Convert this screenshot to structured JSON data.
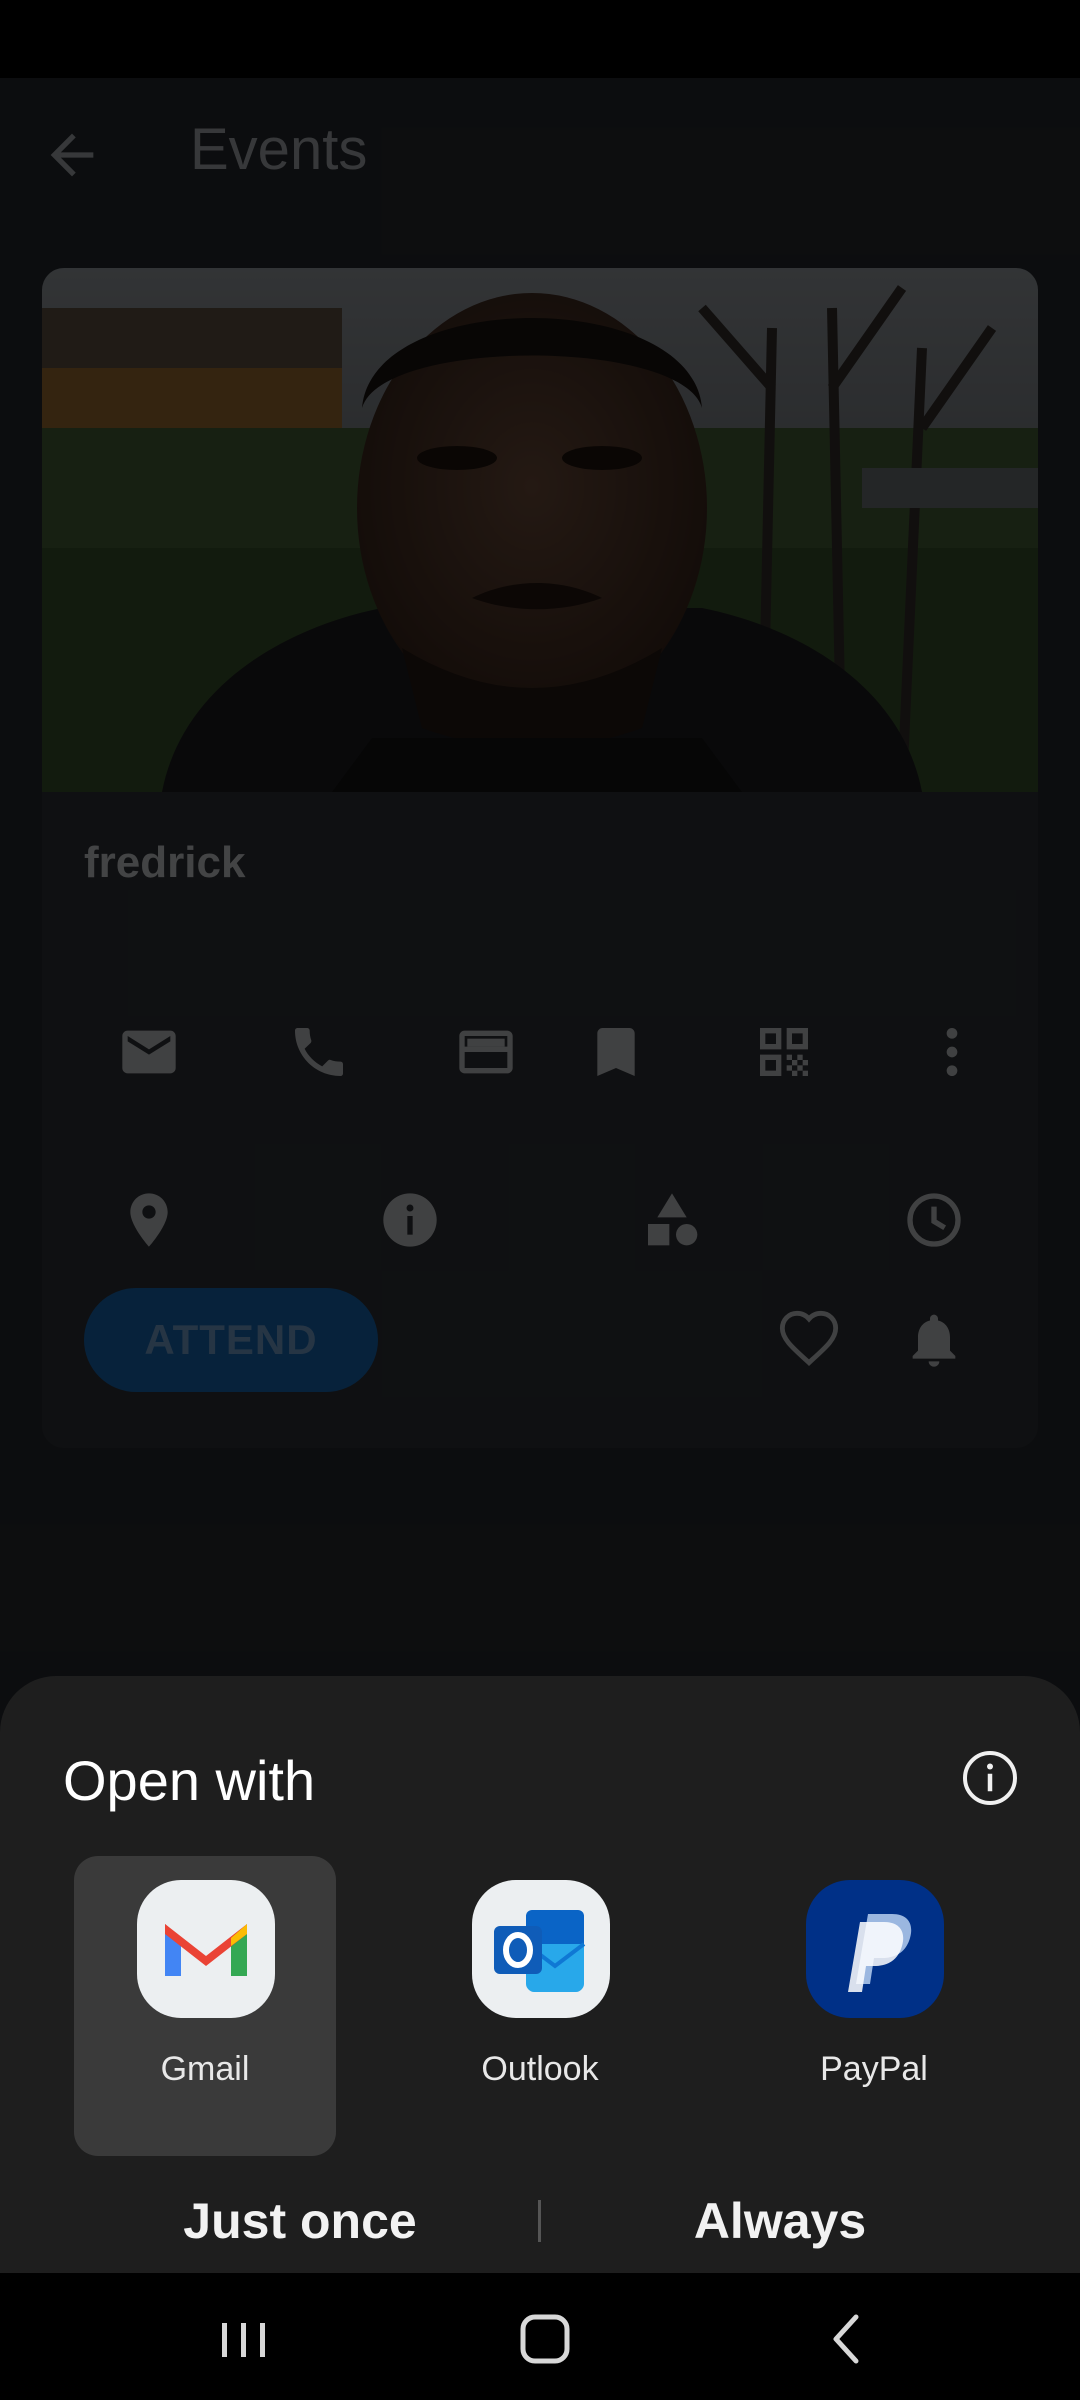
{
  "app_bar": {
    "title": "Events",
    "back_icon": "arrow-back-icon"
  },
  "event_card": {
    "person_name": "fredrick",
    "actions_row1": [
      "email-icon",
      "phone-icon",
      "id-card-icon",
      "bookmark-icon",
      "qr-code-icon",
      "more-vert-icon"
    ],
    "actions_row2": [
      "location-pin-icon",
      "info-icon",
      "shapes-icon",
      "clock-icon"
    ],
    "attend_label": "ATTEND",
    "favorite_icon": "heart-icon",
    "notify_icon": "bell-icon"
  },
  "sheet": {
    "title": "Open with",
    "info_icon": "info-icon",
    "apps": [
      {
        "label": "Gmail",
        "selected": true
      },
      {
        "label": "Outlook",
        "selected": false
      },
      {
        "label": "PayPal",
        "selected": false
      }
    ],
    "just_once_label": "Just once",
    "always_label": "Always"
  },
  "colors": {
    "accent": "#1a73c6",
    "sheet_background": "#1e1e1e",
    "selected_option": "#3a3a3a"
  },
  "nav_bar": {
    "items": [
      "recents-icon",
      "home-icon",
      "back-icon"
    ]
  }
}
